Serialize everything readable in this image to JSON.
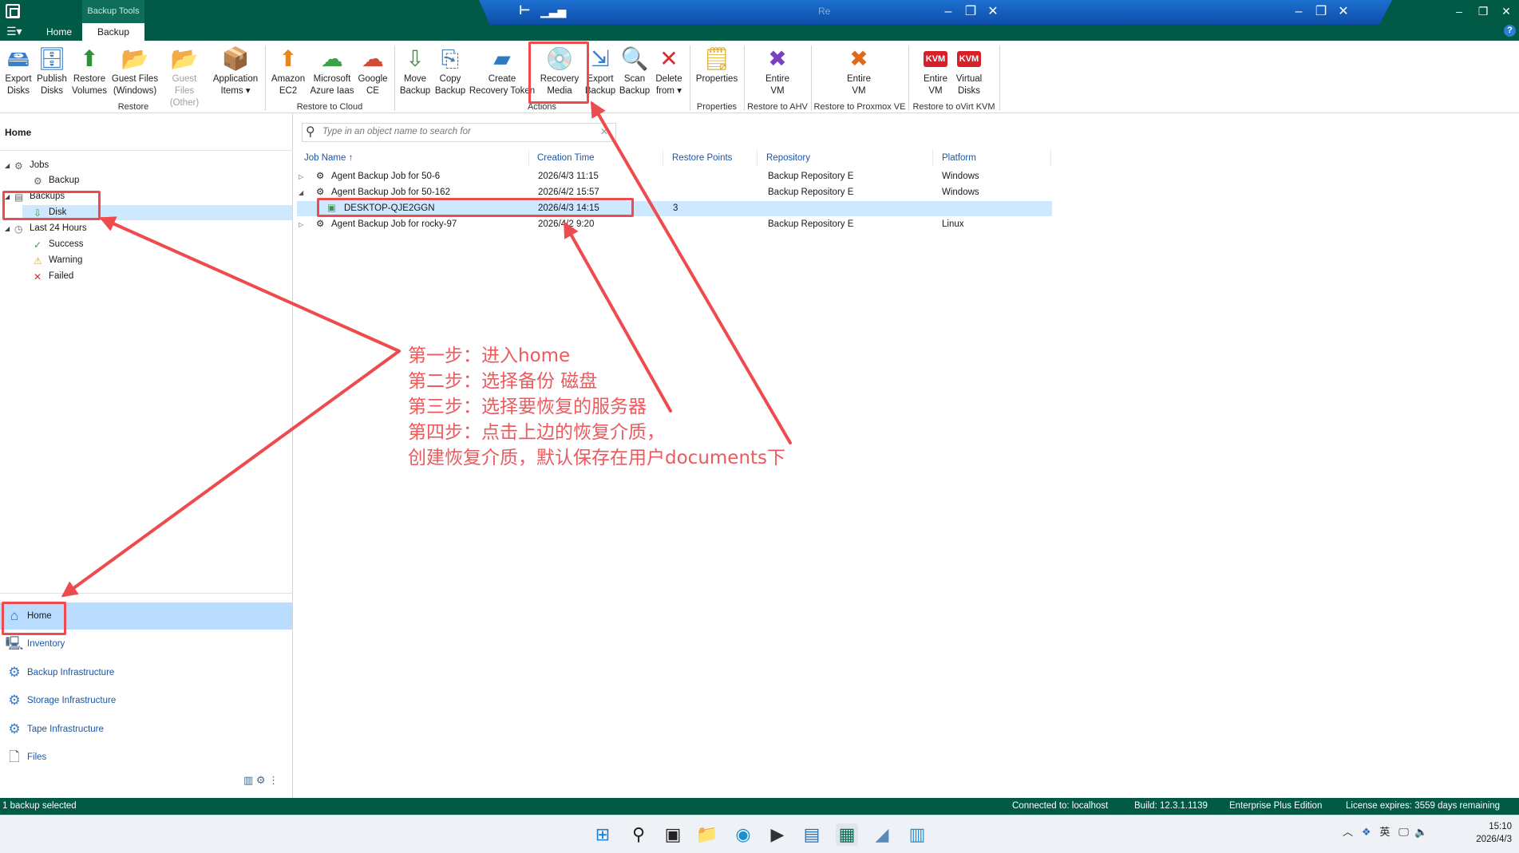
{
  "titlebar": {
    "context_tab": "Backup Tools",
    "tabs": [
      "Home",
      "Backup"
    ],
    "menu_icon": "hamburger-menu-icon",
    "help": "?"
  },
  "ribbon": {
    "groups": [
      {
        "name": "Restore",
        "buttons": [
          {
            "line1": "Export",
            "line2": "Disks",
            "icon": "export-disks-icon",
            "enabled": true
          },
          {
            "line1": "Publish",
            "line2": "Disks",
            "icon": "publish-disks-icon",
            "enabled": true
          },
          {
            "line1": "Restore",
            "line2": "Volumes",
            "icon": "restore-volumes-icon",
            "enabled": true
          },
          {
            "line1": "Guest Files",
            "line2": "(Windows)",
            "icon": "guest-files-windows-icon",
            "enabled": true
          },
          {
            "line1": "Guest Files",
            "line2": "(Other)",
            "icon": "guest-files-other-icon",
            "enabled": false
          },
          {
            "line1": "Application",
            "line2": "Items ▾",
            "icon": "application-items-icon",
            "enabled": true
          }
        ]
      },
      {
        "name": "Restore to Cloud",
        "buttons": [
          {
            "line1": "Amazon",
            "line2": "EC2",
            "icon": "amazon-ec2-icon",
            "enabled": true
          },
          {
            "line1": "Microsoft",
            "line2": "Azure Iaas",
            "icon": "azure-icon",
            "enabled": true
          },
          {
            "line1": "Google",
            "line2": "CE",
            "icon": "google-ce-icon",
            "enabled": true
          }
        ]
      },
      {
        "name": "Actions",
        "buttons": [
          {
            "line1": "Move",
            "line2": "Backup",
            "icon": "move-backup-icon",
            "enabled": true
          },
          {
            "line1": "Copy",
            "line2": "Backup",
            "icon": "copy-backup-icon",
            "enabled": true
          },
          {
            "line1": "Create",
            "line2": "Recovery Token",
            "icon": "recovery-token-icon",
            "enabled": true
          },
          {
            "line1": "Recovery",
            "line2": "Media",
            "icon": "recovery-media-icon",
            "enabled": true
          },
          {
            "line1": "Export",
            "line2": "Backup",
            "icon": "export-backup-icon",
            "enabled": true
          },
          {
            "line1": "Scan",
            "line2": "Backup",
            "icon": "scan-backup-icon",
            "enabled": true
          },
          {
            "line1": "Delete",
            "line2": "from ▾",
            "icon": "delete-icon",
            "enabled": true
          }
        ]
      },
      {
        "name": "Properties",
        "buttons": [
          {
            "line1": "Properties",
            "line2": "",
            "icon": "properties-icon",
            "enabled": true
          }
        ]
      },
      {
        "name": "Restore to AHV",
        "buttons": [
          {
            "line1": "Entire",
            "line2": "VM",
            "icon": "ahv-vm-icon",
            "enabled": true
          }
        ]
      },
      {
        "name": "Restore to Proxmox VE",
        "buttons": [
          {
            "line1": "Entire",
            "line2": "VM",
            "icon": "proxmox-vm-icon",
            "enabled": true
          }
        ]
      },
      {
        "name": "Restore to oVirt KVM",
        "buttons": [
          {
            "line1": "Entire",
            "line2": "VM",
            "icon": "kvm-vm-icon",
            "enabled": true
          },
          {
            "line1": "Virtual",
            "line2": "Disks",
            "icon": "kvm-disks-icon",
            "enabled": true
          }
        ]
      }
    ],
    "kvm_badge": "KVM"
  },
  "left": {
    "header": "Home",
    "tree": [
      {
        "label": "Jobs",
        "arrow": "◢"
      },
      {
        "label": "Backup",
        "arrow": ""
      },
      {
        "label": "Backups",
        "arrow": "◢"
      },
      {
        "label": "Disk",
        "arrow": ""
      },
      {
        "label": "Last 24 Hours",
        "arrow": "◢"
      },
      {
        "label": "Success",
        "arrow": ""
      },
      {
        "label": "Warning",
        "arrow": ""
      },
      {
        "label": "Failed",
        "arrow": ""
      }
    ],
    "nav": [
      "Home",
      "Inventory",
      "Backup Infrastructure",
      "Storage Infrastructure",
      "Tape Infrastructure",
      "Files"
    ]
  },
  "content": {
    "search_placeholder": "Type in an object name to search for",
    "columns": [
      "Job Name",
      "Creation Time",
      "Restore Points",
      "Repository",
      "Platform"
    ],
    "sort_arrow": "↑",
    "rows": [
      {
        "arrow": "▷",
        "name": "Agent Backup Job for 50-6",
        "time": "2026/4/3 11:15",
        "points": "",
        "repo": "Backup Repository E",
        "platform": "Windows"
      },
      {
        "arrow": "◢",
        "name": "Agent Backup Job for 50-162",
        "time": "2026/4/2 15:57",
        "points": "",
        "repo": "Backup Repository E",
        "platform": "Windows"
      },
      {
        "arrow": "",
        "name": "DESKTOP-QJE2GGN",
        "time": "2026/4/3 14:15",
        "points": "3",
        "repo": "",
        "platform": ""
      },
      {
        "arrow": "▷",
        "name": "Agent Backup Job for rocky-97",
        "time": "2026/4/2 9:20",
        "points": "",
        "repo": "Backup Repository E",
        "platform": "Linux"
      }
    ]
  },
  "annotation": {
    "lines": [
      "第一步：进入home",
      "第二步：选择备份 磁盘",
      "第三步：选择要恢复的服务器",
      "第四步：点击上边的恢复介质，",
      "创建恢复介质，默认保存在用户documents下"
    ],
    "color": "#ee4b4f"
  },
  "status": {
    "left": "1 backup selected",
    "connected": "Connected to: localhost",
    "build": "Build: 12.3.1.1139",
    "edition": "Enterprise Plus Edition",
    "license": "License expires: 3559 days remaining"
  },
  "taskbar": {
    "ime": "英",
    "time": "15:10",
    "date": "2026/4/3"
  },
  "colors": {
    "brand": "#005a46",
    "selection": "#cde8ff",
    "link": "#1a56a6",
    "rdp": "#1c6fd0"
  }
}
